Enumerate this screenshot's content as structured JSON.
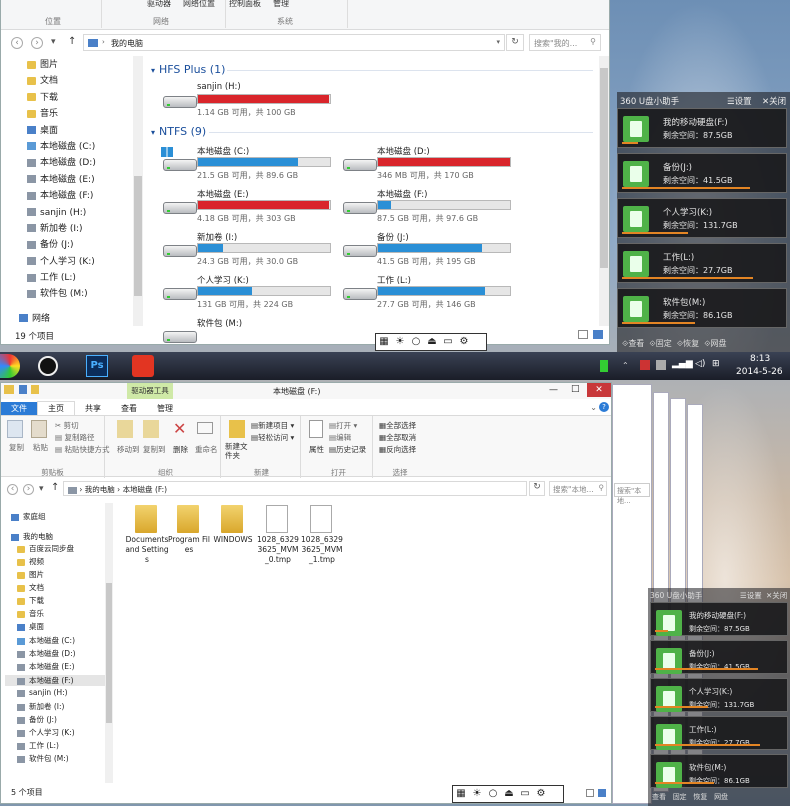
{
  "top_window": {
    "ribbon_groups": [
      "位置",
      "网络",
      "系统"
    ],
    "ribbon_items": [
      "驱动器",
      "网络位置",
      "控制面板",
      "管理"
    ],
    "breadcrumb": "我的电脑",
    "search_placeholder": "搜索\"我的...",
    "tree": [
      "图片",
      "文档",
      "下载",
      "音乐",
      "桌面",
      "本地磁盘 (C:)",
      "本地磁盘 (D:)",
      "本地磁盘 (E:)",
      "本地磁盘 (F:)",
      "sanjin (H:)",
      "新加卷 (I:)",
      "备份 (J:)",
      "个人学习 (K:)",
      "工作 (L:)",
      "软件包 (M:)",
      "网络"
    ],
    "item_count": "19 个项目",
    "groups": [
      {
        "title": "HFS Plus (1)"
      },
      {
        "title": "NTFS (9)"
      }
    ],
    "drives": [
      {
        "name": "sanjin (H:)",
        "free": "1.14 GB 可用，共 100 GB",
        "fill": 0.99,
        "color": "#d9252b"
      },
      {
        "name": "本地磁盘 (C:)",
        "free": "21.5 GB 可用，共 89.6 GB",
        "fill": 0.76,
        "color": "#2a8fd6"
      },
      {
        "name": "本地磁盘 (D:)",
        "free": "346 MB 可用，共 170 GB",
        "fill": 0.998,
        "color": "#d9252b"
      },
      {
        "name": "本地磁盘 (E:)",
        "free": "4.18 GB 可用，共 303 GB",
        "fill": 0.99,
        "color": "#d9252b"
      },
      {
        "name": "本地磁盘 (F:)",
        "free": "87.5 GB 可用，共 97.6 GB",
        "fill": 0.1,
        "color": "#2a8fd6"
      },
      {
        "name": "新加卷 (I:)",
        "free": "24.3 GB 可用，共 30.0 GB",
        "fill": 0.19,
        "color": "#2a8fd6"
      },
      {
        "name": "备份 (J:)",
        "free": "41.5 GB 可用，共 195 GB",
        "fill": 0.79,
        "color": "#2a8fd6"
      },
      {
        "name": "个人学习 (K:)",
        "free": "131 GB 可用，共 224 GB",
        "fill": 0.41,
        "color": "#2a8fd6"
      },
      {
        "name": "工作 (L:)",
        "free": "27.7 GB 可用，共 146 GB",
        "fill": 0.81,
        "color": "#2a8fd6"
      },
      {
        "name": "软件包 (M:)",
        "free": "",
        "fill": 0,
        "color": "#2a8fd6"
      }
    ]
  },
  "usb_helper": {
    "title": "360 U盘小助手",
    "settings": "设置",
    "close": "关闭",
    "cards": [
      {
        "name": "我的移动硬盘(F:)",
        "free": "剩余空间：87.5GB",
        "used": 0.1
      },
      {
        "name": "备份(J:)",
        "free": "剩余空间：41.5GB",
        "used": 0.79
      },
      {
        "name": "个人学习(K:)",
        "free": "剩余空间：131.7GB",
        "used": 0.41
      },
      {
        "name": "工作(L:)",
        "free": "剩余空间：27.7GB",
        "used": 0.81
      },
      {
        "name": "软件包(M:)",
        "free": "剩余空间：86.1GB",
        "used": 0.45
      }
    ],
    "footer": [
      "查看",
      "固定",
      "恢复",
      "网盘"
    ]
  },
  "taskbar": {
    "time": "8:13",
    "date": "2014-5-26"
  },
  "bottom_window": {
    "title": "本地磁盘 (F:)",
    "context_tab": "驱动器工具",
    "tabs": [
      "文件",
      "主页",
      "共享",
      "查看",
      "管理"
    ],
    "groups": [
      "剪贴板",
      "组织",
      "新建",
      "打开",
      "选择"
    ],
    "clipboard": [
      "复制",
      "粘贴",
      "剪切",
      "复制路径",
      "粘贴快捷方式"
    ],
    "organize": [
      "移动到",
      "复制到",
      "删除",
      "重命名"
    ],
    "new": [
      "新建文件夹",
      "新建项目 ▾",
      "轻松访问 ▾"
    ],
    "open": [
      "属性",
      "打开 ▾",
      "编辑",
      "历史记录"
    ],
    "select": [
      "全部选择",
      "全部取消",
      "反向选择"
    ],
    "breadcrumb": [
      "我的电脑",
      "本地磁盘 (F:)"
    ],
    "search_placeholder": "搜索\"本地...",
    "tree": [
      "家庭组",
      "我的电脑",
      "百度云同步盘",
      "视频",
      "图片",
      "文档",
      "下载",
      "音乐",
      "桌面",
      "本地磁盘 (C:)",
      "本地磁盘 (D:)",
      "本地磁盘 (E:)",
      "本地磁盘 (F:)",
      "sanjin (H:)",
      "新加卷 (I:)",
      "备份 (J:)",
      "个人学习 (K:)",
      "工作 (L:)",
      "软件包 (M:)"
    ],
    "files": [
      {
        "name": "Documents and Settings",
        "type": "folder"
      },
      {
        "name": "Program Files",
        "type": "folder"
      },
      {
        "name": "WINDOWS",
        "type": "folder"
      },
      {
        "name": "1028_63293625_MVM_0.tmp",
        "type": "file"
      },
      {
        "name": "1028_63293625_MVM_1.tmp",
        "type": "file"
      }
    ],
    "item_count": "5 个项目"
  },
  "bottom_search2": "搜索\"本地..."
}
